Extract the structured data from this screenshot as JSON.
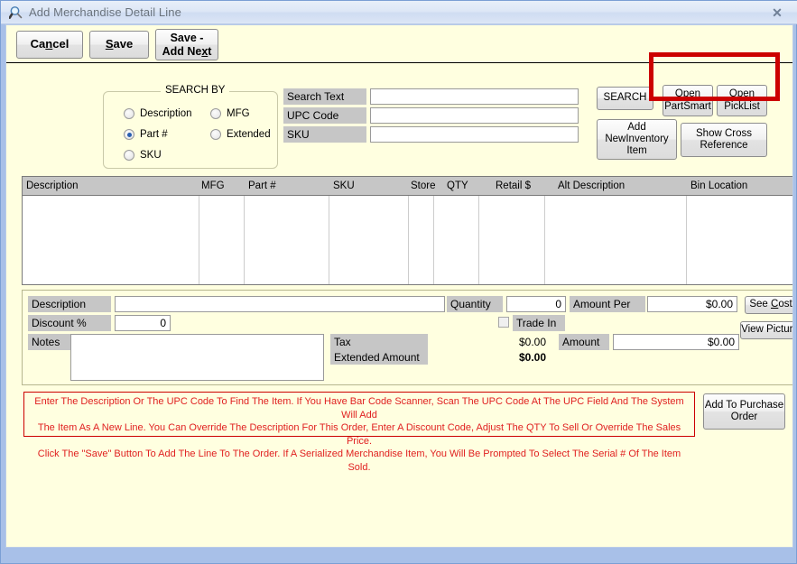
{
  "window": {
    "title": "Add Merchandise Detail Line",
    "icon": "magnifier-icon",
    "close_label": "✕"
  },
  "toolbar": {
    "cancel_label": "Cancel",
    "save_label": "Save",
    "save_add_next_label": "Save - Add Next"
  },
  "search_by": {
    "legend": "SEARCH BY",
    "options": [
      {
        "label": "Description",
        "checked": false
      },
      {
        "label": "MFG",
        "checked": false
      },
      {
        "label": "Part #",
        "checked": true
      },
      {
        "label": "Extended",
        "checked": false
      },
      {
        "label": "SKU",
        "checked": false
      }
    ]
  },
  "search_fields": [
    {
      "label": "Search Text",
      "value": "",
      "placeholder": ""
    },
    {
      "label": "UPC Code",
      "value": "",
      "placeholder": ""
    },
    {
      "label": "SKU",
      "value": "",
      "placeholder": ""
    }
  ],
  "action_buttons": {
    "search": "SEARCH",
    "open_partsmart": "Open PartSmart",
    "open_picklist": "Open PickList",
    "add_new_inventory_item": "Add NewInventory Item",
    "show_cross_reference": "Show Cross Reference"
  },
  "grid": {
    "columns": [
      "Description",
      "MFG",
      "Part #",
      "SKU",
      "Store",
      "QTY",
      "Retail $",
      "Alt Description",
      "Bin Location"
    ],
    "rows": []
  },
  "detail": {
    "description_label": "Description",
    "description_value": "",
    "discount_label": "Discount %",
    "discount_value": "0",
    "notes_label": "Notes",
    "notes_value": "",
    "quantity_label": "Quantity",
    "quantity_value": "0",
    "amount_per_label": "Amount Per",
    "amount_per_value": "$0.00",
    "trade_in_label": "Trade In",
    "trade_in_checked": false,
    "tax_label": "Tax",
    "tax_value": "$0.00",
    "extended_amount_label": "Extended Amount",
    "extended_amount_value": "$0.00",
    "amount_label": "Amount",
    "amount_value": "$0.00",
    "see_cost_label": "See Cost",
    "view_picture_label": "View Picture"
  },
  "instructions": {
    "line1": "Enter The Description Or The UPC Code To Find The Item. If You Have Bar Code Scanner, Scan The UPC Code At The UPC Field And The System Will Add",
    "line2": "The Item As A New Line. You Can Override The Description For This Order, Enter A Discount Code, Adjust The QTY To Sell Or Override The Sales Price.",
    "line3": "Click The \"Save\" Button To Add The Line To The Order. If A Serialized Merchandise Item, You Will Be Prompted To Select The Serial # Of The Item Sold."
  },
  "purchase_order": {
    "add_to_purchase_order_label": "Add To Purchase Order"
  },
  "colors": {
    "window_frame": "#a8c0e8",
    "client_bg": "#ffffe0",
    "label_bg": "#c6c6c6",
    "instruction_text": "#e02020",
    "highlight_border": "#cc0000",
    "radio_selected": "#2b5fb0"
  }
}
